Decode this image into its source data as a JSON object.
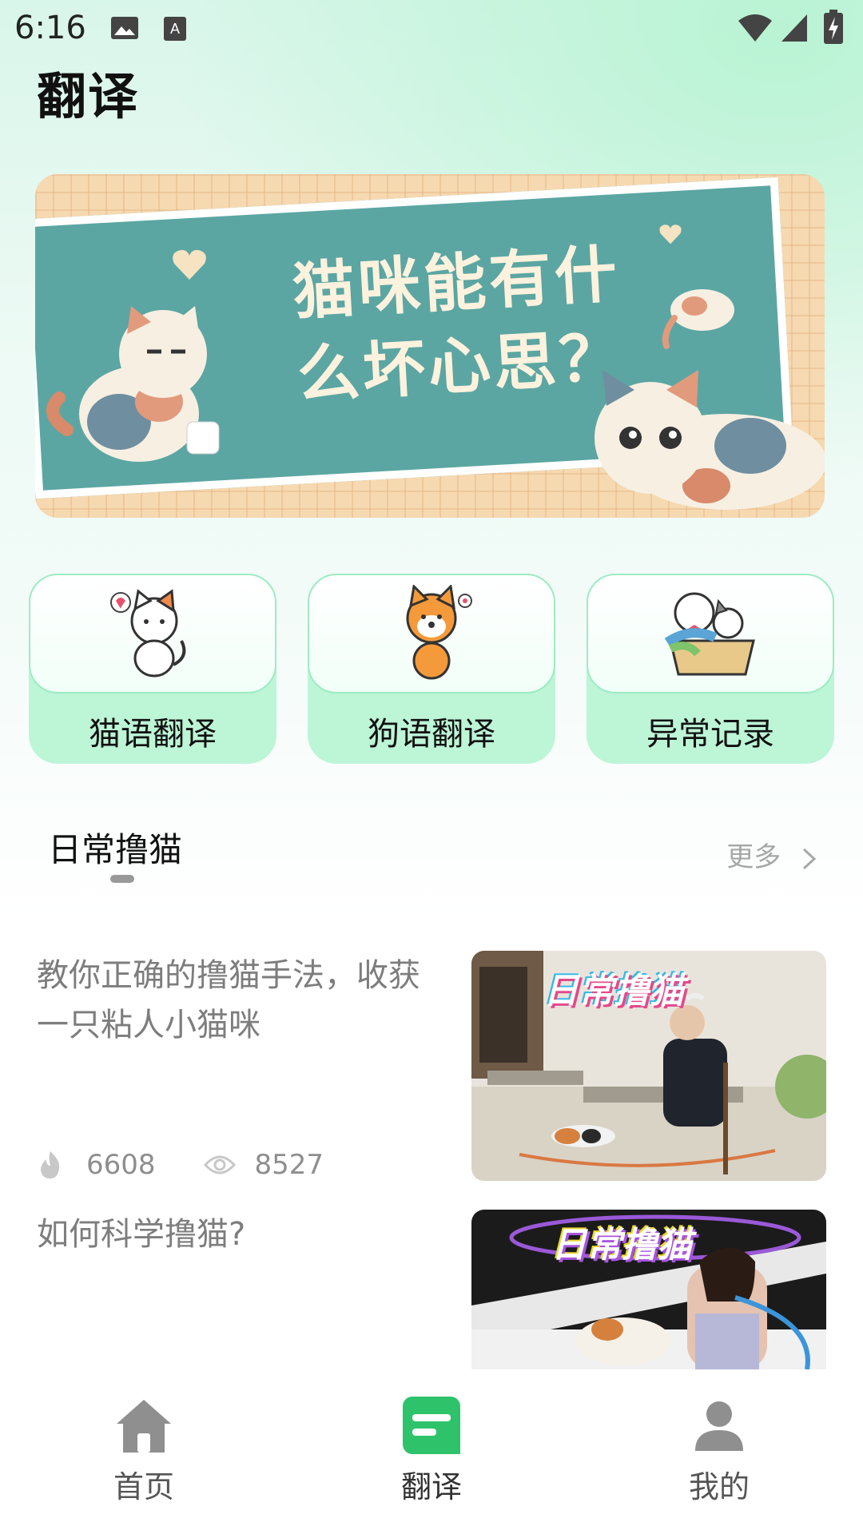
{
  "status_bar": {
    "time": "6:16"
  },
  "header": {
    "title": "翻译"
  },
  "banner": {
    "text_line1": "猫咪能有什",
    "text_line2": "么坏心思？"
  },
  "quick_actions": [
    {
      "label": "猫语翻译",
      "icon": "cat-icon"
    },
    {
      "label": "狗语翻译",
      "icon": "dog-icon"
    },
    {
      "label": "异常记录",
      "icon": "pets-basket-icon"
    }
  ],
  "section": {
    "title": "日常撸猫",
    "more_label": "更多"
  },
  "articles": [
    {
      "title": "教你正确的撸猫手法，收获一只粘人小猫咪",
      "likes": "6608",
      "views": "8527",
      "thumb_caption": "日常撸猫"
    },
    {
      "title": "如何科学撸猫?",
      "thumb_caption": "日常撸猫"
    }
  ],
  "tabbar": {
    "items": [
      {
        "label": "首页",
        "icon": "home-icon"
      },
      {
        "label": "翻译",
        "icon": "translate-icon",
        "active": true
      },
      {
        "label": "我的",
        "icon": "profile-icon"
      }
    ]
  },
  "colors": {
    "accent": "#2ec36b",
    "quick_bg": "#bdf5d7",
    "banner_teal": "#5ba6a2"
  }
}
